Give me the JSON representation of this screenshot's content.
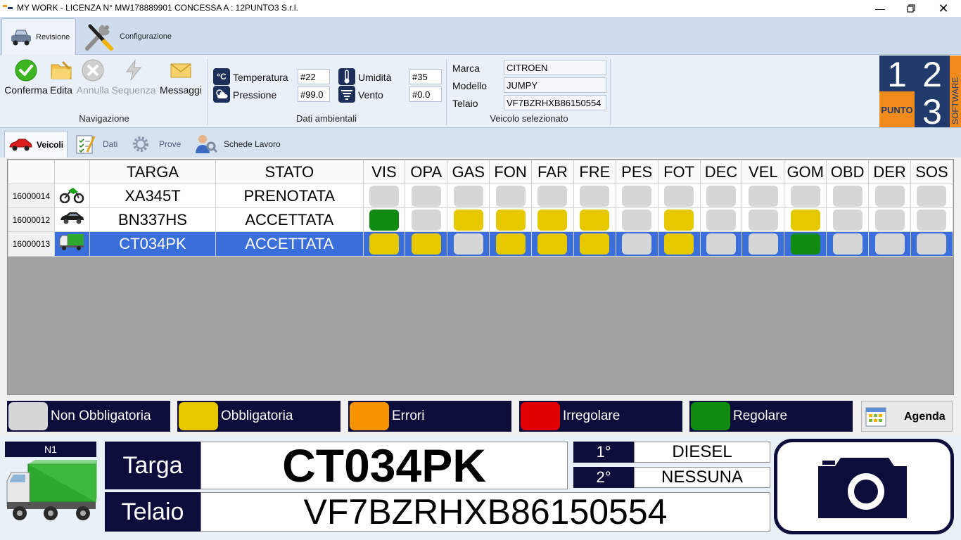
{
  "window": {
    "title": "MY WORK - LICENZA N° MW178889901 CONCESSA A : 12PUNTO3 S.r.l.",
    "controls": [
      "minimize-icon",
      "restore-icon",
      "close-icon"
    ]
  },
  "ribbon_tabs": [
    {
      "label": "Revisione",
      "icon": "car-icon",
      "active": true
    },
    {
      "label": "Configurazione",
      "icon": "tools-icon",
      "active": false
    }
  ],
  "navigazione": {
    "group_label": "Navigazione",
    "buttons": [
      {
        "label": "Conferma",
        "icon": "check-icon",
        "enabled": true
      },
      {
        "label": "Edita",
        "icon": "folder-edit-icon",
        "enabled": true
      },
      {
        "label": "Annulla",
        "icon": "cancel-icon",
        "enabled": false
      },
      {
        "label": "Sequenza",
        "icon": "lightning-icon",
        "enabled": false
      },
      {
        "label": "Messaggi",
        "icon": "envelope-icon",
        "enabled": true
      }
    ]
  },
  "ambiente": {
    "group_label": "Dati ambientali",
    "temperatura": {
      "label": "Temperatura",
      "value": "#22",
      "icon": "celsius-icon"
    },
    "pressione": {
      "label": "Pressione",
      "value": "#99.0",
      "icon": "weather-icon"
    },
    "umidita": {
      "label": "Umidità",
      "value": "#35",
      "icon": "thermometer-icon"
    },
    "vento": {
      "label": "Vento",
      "value": "#0.0",
      "icon": "wind-icon"
    }
  },
  "veicolo": {
    "group_label": "Veicolo selezionato",
    "marca": {
      "label": "Marca",
      "value": "CITROEN"
    },
    "modello": {
      "label": "Modello",
      "value": "JUMPY"
    },
    "telaio": {
      "label": "Telaio",
      "value": "VF7BZRHXB86150554"
    }
  },
  "logo": {
    "digits": [
      "1",
      "2",
      "3"
    ],
    "punto": "PUNTO",
    "software": "SOFTWARE",
    "colors": {
      "dark": "#1f3a6b",
      "orange": "#f08a1c"
    }
  },
  "subtabs": [
    {
      "label": "Veicoli",
      "icon": "red-car-icon",
      "active": true
    },
    {
      "label": "Dati",
      "icon": "checklist-icon",
      "active": false
    },
    {
      "label": "Prove",
      "icon": "gear-icon",
      "active": false
    },
    {
      "label": "Schede Lavoro",
      "icon": "users-icon",
      "active": false
    }
  ],
  "grid": {
    "headers": [
      "TARGA",
      "STATO",
      "VIS",
      "OPA",
      "GAS",
      "FON",
      "FAR",
      "FRE",
      "PES",
      "FOT",
      "DEC",
      "VEL",
      "GOM",
      "OBD",
      "DER",
      "SOS"
    ],
    "rows": [
      {
        "id": "16000014",
        "vehicle": "motorcycle-icon",
        "targa": "XA345T",
        "stato": "PRENOTATA",
        "selected": false,
        "checks": [
          "grey",
          "grey",
          "grey",
          "grey",
          "grey",
          "grey",
          "grey",
          "grey",
          "grey",
          "grey",
          "grey",
          "grey",
          "grey",
          "grey"
        ]
      },
      {
        "id": "16000012",
        "vehicle": "car-icon",
        "targa": "BN337HS",
        "stato": "ACCETTATA",
        "selected": false,
        "checks": [
          "green",
          "grey",
          "yellow",
          "yellow",
          "yellow",
          "yellow",
          "grey",
          "yellow",
          "grey",
          "grey",
          "yellow",
          "grey",
          "grey",
          "grey"
        ]
      },
      {
        "id": "16000013",
        "vehicle": "truck-icon",
        "targa": "CT034PK",
        "stato": "ACCETTATA",
        "selected": true,
        "checks": [
          "yellow",
          "yellow",
          "grey",
          "yellow",
          "yellow",
          "yellow",
          "grey",
          "yellow",
          "grey",
          "grey",
          "green",
          "grey",
          "grey",
          "grey"
        ]
      }
    ]
  },
  "status_colors": {
    "grey": "#d6d6d6",
    "yellow": "#e6c800",
    "orange": "#f59300",
    "red": "#e00000",
    "green": "#118a11"
  },
  "legend": [
    {
      "label": "Non Obbligatoria",
      "color": "grey"
    },
    {
      "label": "Obbligatoria",
      "color": "yellow"
    },
    {
      "label": "Errori",
      "color": "orange"
    },
    {
      "label": "Irregolare",
      "color": "red"
    },
    {
      "label": "Regolare",
      "color": "green"
    }
  ],
  "agenda": {
    "label": "Agenda",
    "icon": "calendar-icon"
  },
  "detail": {
    "category": "N1",
    "vehicle_icon": "green-truck-icon",
    "targa_label": "Targa",
    "targa_value": "CT034PK",
    "telaio_label": "Telaio",
    "telaio_value": "VF7BZRHXB86150554",
    "fuel1_label": "1°",
    "fuel1_value": "DIESEL",
    "fuel2_label": "2°",
    "fuel2_value": "NESSUNA",
    "camera_icon": "camera-icon"
  }
}
